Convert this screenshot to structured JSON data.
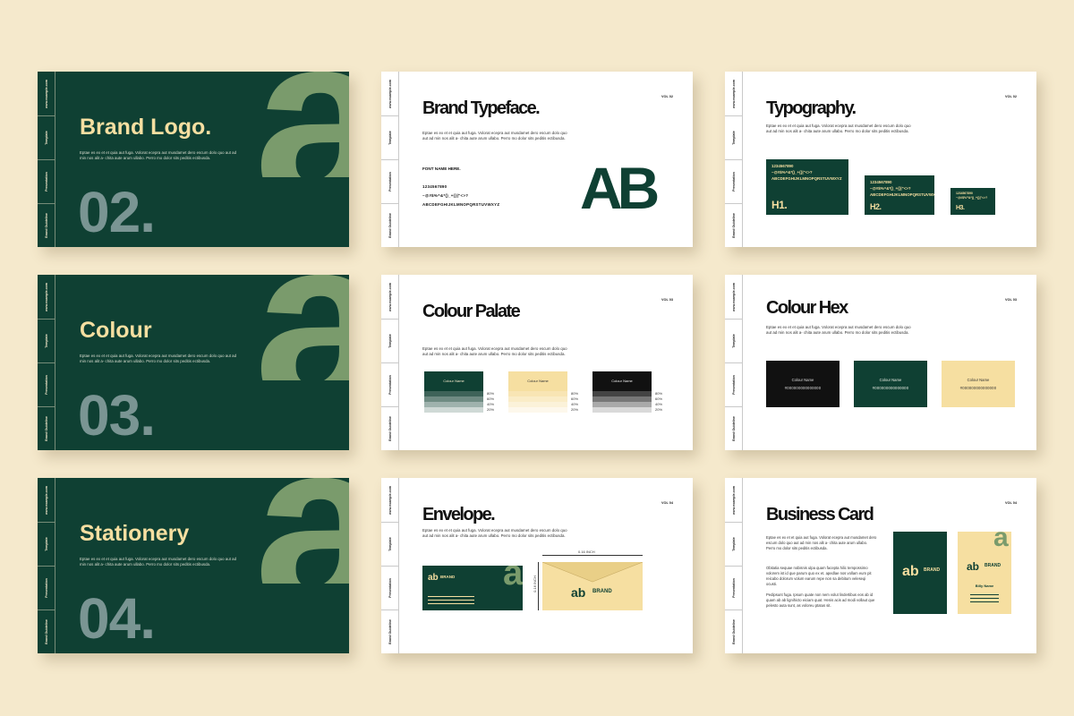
{
  "tabs": [
    "www.example.com",
    "Template",
    "Presentation",
    "Brand Guideline"
  ],
  "lorem": "Eptae es ex et et quia aut fuga. Volorat ecepra aut musdamet dero escum dolo quo aut ad min nos alit a- chita aute arum ullabo. Perro mo dolor sits peditis ectibusda.",
  "section_slides": [
    {
      "title": "Brand Logo.",
      "number": "02."
    },
    {
      "title": "Colour",
      "number": "03."
    },
    {
      "title": "Stationery",
      "number": "04."
    }
  ],
  "big_letter": "a",
  "typeface": {
    "title": "Brand Typeface.",
    "vol": "VOL 02",
    "font_name": "FONT NAME HERE.",
    "digits": "1234567890",
    "symbols": "~@#$%^&*()_+{}|\"<>?",
    "alphabet": "ABCDEFGHIJKLMNOPQRSTUVWXYZ",
    "sample": "AB"
  },
  "typography": {
    "title": "Typography.",
    "vol": "VOL 02",
    "h1": "H1.",
    "h2": "H2.",
    "h3": "H3."
  },
  "palette": {
    "title": "Colour Palate",
    "vol": "VOL 03",
    "swatch_label": "Colour Name",
    "shade_labels": [
      "80%",
      "60%",
      "40%",
      "20%"
    ],
    "colors": {
      "green": "#0f4033",
      "cream": "#f6dfa1",
      "black": "#111111"
    }
  },
  "hex": {
    "title": "Colour Hex",
    "vol": "VOL 03",
    "swatch_label": "Colour Name",
    "hex_value": "#000000000000000"
  },
  "envelope": {
    "title": "Envelope.",
    "vol": "VOL 04",
    "width_label": "0.16 INCH",
    "height_label": "0.16 INCH",
    "brand": "BRAND",
    "mark": "ab"
  },
  "business": {
    "title": "Business Card",
    "vol": "VOL 04",
    "body2": "Obitatia sequae nobisnis ulpa quam facepta hilic tempossimo volorem ist id que parum quo ex et. apedlae nos vollam eum pit reicabo dolorum volum earum repe non sa debitum veleseqi ocusti.",
    "body3": "Pedipsunt fuga. Ipsum quate non nem volut lindertibus eos ab id quam ab ab lignihicto eiciam quat. Henis acis ad modi vollaut que pelesto auta sunt, as voloreu ptatus sit.",
    "brand": "BRAND",
    "mark": "ab",
    "name": "Billy Name"
  }
}
